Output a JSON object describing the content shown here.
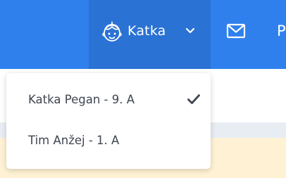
{
  "navbar": {
    "user_menu": {
      "icon": "child-avatar-icon",
      "name": "Katka",
      "chevron_icon": "chevron-down-icon"
    },
    "mail_icon": "mail-icon",
    "clipped_label": "P"
  },
  "dropdown": {
    "items": [
      {
        "label": "Katka Pegan - 9. A",
        "selected": true,
        "icon": "check-icon"
      },
      {
        "label": "Tim Anžej - 1. A",
        "selected": false
      }
    ]
  },
  "colors": {
    "navbar": "#2f80ed",
    "navbar_active": "#2a72d4",
    "menu_text": "#3f4652",
    "notice_bg": "#fff2d4"
  }
}
